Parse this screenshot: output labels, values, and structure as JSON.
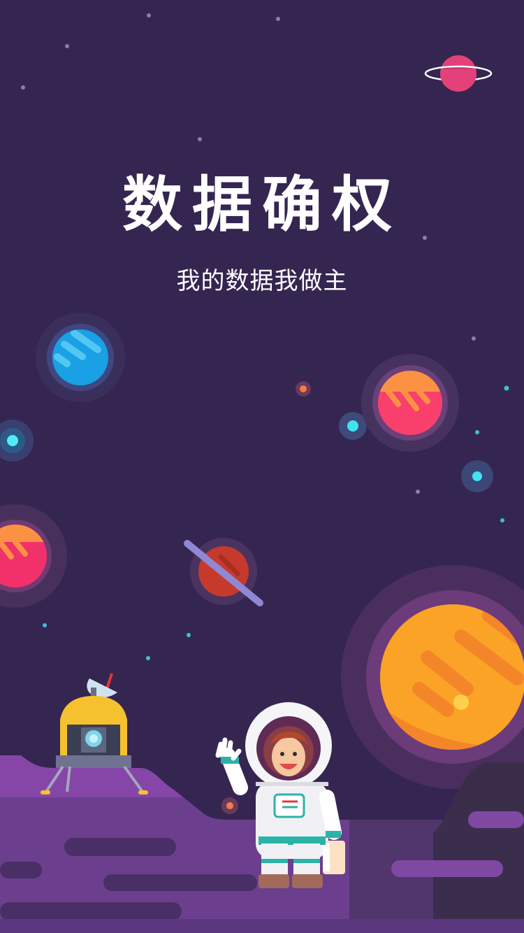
{
  "splash": {
    "title": "数据确权",
    "subtitle": "我的数据我做主"
  },
  "illustration": {
    "elements": [
      "ringed-planet-icon",
      "blue-planet-icon",
      "orange-planet-icon",
      "red-planet-icon",
      "saturn-planet-icon",
      "sun-icon",
      "lunar-lander-icon",
      "astronaut-icon",
      "stars-icon"
    ]
  },
  "colors": {
    "background": "#352551",
    "ground": "#6b3f8e",
    "sun": "#f9a825"
  }
}
